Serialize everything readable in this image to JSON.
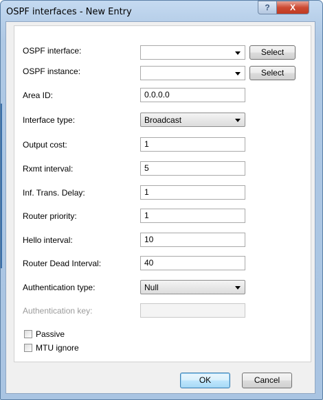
{
  "window": {
    "title": "OSPF interfaces - New Entry",
    "help_glyph": "?",
    "close_glyph": "X"
  },
  "form": {
    "ospf_interface": {
      "label": "OSPF interface:",
      "value": "",
      "button": "Select"
    },
    "ospf_instance": {
      "label": "OSPF instance:",
      "value": "",
      "button": "Select"
    },
    "area_id": {
      "label": "Area ID:",
      "value": "0.0.0.0"
    },
    "interface_type": {
      "label": "Interface type:",
      "value": "Broadcast"
    },
    "output_cost": {
      "label": "Output cost:",
      "value": "1"
    },
    "rxmt_interval": {
      "label": "Rxmt interval:",
      "value": "5"
    },
    "inf_trans_delay": {
      "label": "Inf. Trans. Delay:",
      "value": "1"
    },
    "router_priority": {
      "label": "Router priority:",
      "value": "1"
    },
    "hello_interval": {
      "label": "Hello interval:",
      "value": "10"
    },
    "router_dead_interval": {
      "label": "Router Dead Interval:",
      "value": "40"
    },
    "authentication_type": {
      "label": "Authentication type:",
      "value": "Null"
    },
    "authentication_key": {
      "label": "Authentication key:",
      "value": ""
    },
    "passive": {
      "label": "Passive",
      "checked": false
    },
    "mtu_ignore": {
      "label": "MTU ignore",
      "checked": false
    }
  },
  "footer": {
    "ok_label": "OK",
    "cancel_label": "Cancel"
  }
}
